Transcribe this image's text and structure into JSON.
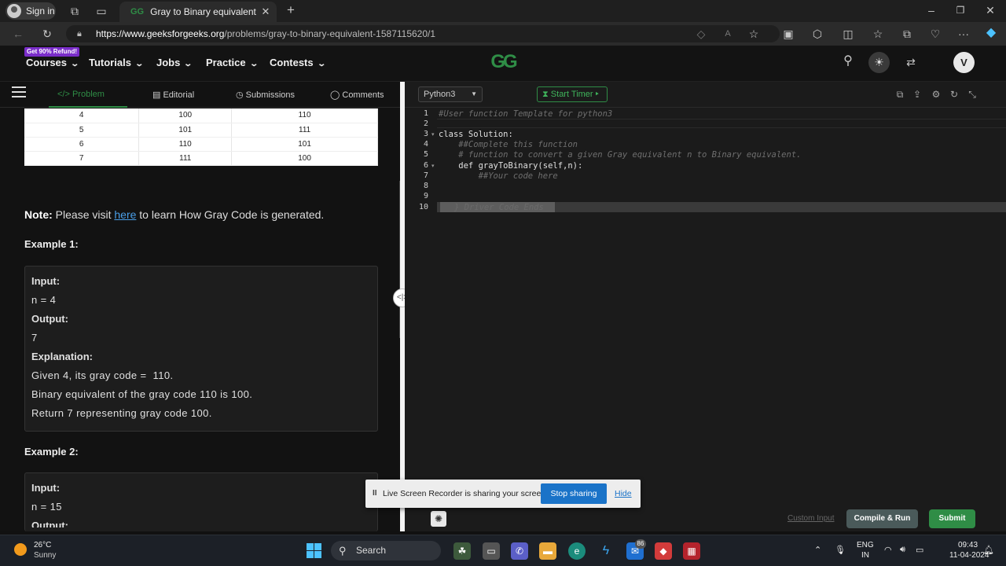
{
  "browser": {
    "signin_label": "Sign in",
    "tab_title": "Gray to Binary equivalent | Practi",
    "new_tab_icon": "plus-icon",
    "url_host": "https://www.geeksforgeeks.org",
    "url_path": "/problems/gray-to-binary-equivalent-1587115620/1"
  },
  "nav": {
    "promo": "Get 90% Refund!",
    "items": [
      "Courses",
      "Tutorials",
      "Jobs",
      "Practice",
      "Contests"
    ],
    "logo": "GG",
    "avatar_letter": "V"
  },
  "problem_tabs": {
    "items": [
      {
        "label": "Problem",
        "icon": "</>"
      },
      {
        "label": "Editorial",
        "icon": "doc-icon"
      },
      {
        "label": "Submissions",
        "icon": "clock-icon"
      },
      {
        "label": "Comments",
        "icon": "comment-icon"
      }
    ]
  },
  "table": {
    "rows": [
      [
        "4",
        "100",
        "110"
      ],
      [
        "5",
        "101",
        "111"
      ],
      [
        "6",
        "110",
        "101"
      ],
      [
        "7",
        "111",
        "100"
      ]
    ]
  },
  "note": {
    "label": "Note:",
    "before": " Please visit ",
    "link": "here",
    "after": " to learn How Gray Code is generated."
  },
  "example1": {
    "title": "Example 1:",
    "input_label": "Input:",
    "input_value": "n = 4",
    "output_label": "Output:",
    "output_value": "7",
    "explanation_label": "Explanation:",
    "explanation_lines": [
      "Given 4, its gray code =  110.",
      "Binary equivalent of the gray code 110 is 100.",
      "Return 7 representing gray code 100."
    ]
  },
  "example2": {
    "title": "Example 2:",
    "input_label": "Input:",
    "input_value": "n = 15",
    "output_label": "Output:"
  },
  "editor": {
    "language": "Python3",
    "timer_label": "Start Timer",
    "lines": [
      {
        "n": "1",
        "text": "#User function Template for python3"
      },
      {
        "n": "2",
        "text": ""
      },
      {
        "n": "3",
        "text": "class Solution:"
      },
      {
        "n": "4",
        "text": "    ##Complete this function"
      },
      {
        "n": "5",
        "text": "    # function to convert a given Gray equivalent n to Binary equivalent."
      },
      {
        "n": "6",
        "text": "    def grayToBinary(self,n):"
      },
      {
        "n": "7",
        "text": "        ##Your code here"
      },
      {
        "n": "8",
        "text": ""
      },
      {
        "n": "9",
        "text": ""
      },
      {
        "n": "10",
        "text": "// } Driver Code Ends"
      }
    ],
    "custom_input": "Custom Input",
    "compile_run": "Compile & Run",
    "submit": "Submit"
  },
  "share_banner": {
    "pause": "II",
    "message": "Live Screen Recorder is sharing your screen.",
    "stop": "Stop sharing",
    "hide": "Hide"
  },
  "taskbar": {
    "temp": "26°C",
    "weather": "Sunny",
    "search": "Search",
    "badge": "86",
    "lang1": "ENG",
    "lang2": "IN",
    "time": "09:43",
    "date": "11-04-2024"
  },
  "colors": {
    "gfg_green": "#2f8d46",
    "link_blue": "#4a9fe8",
    "stop_blue": "#1a73c8"
  }
}
